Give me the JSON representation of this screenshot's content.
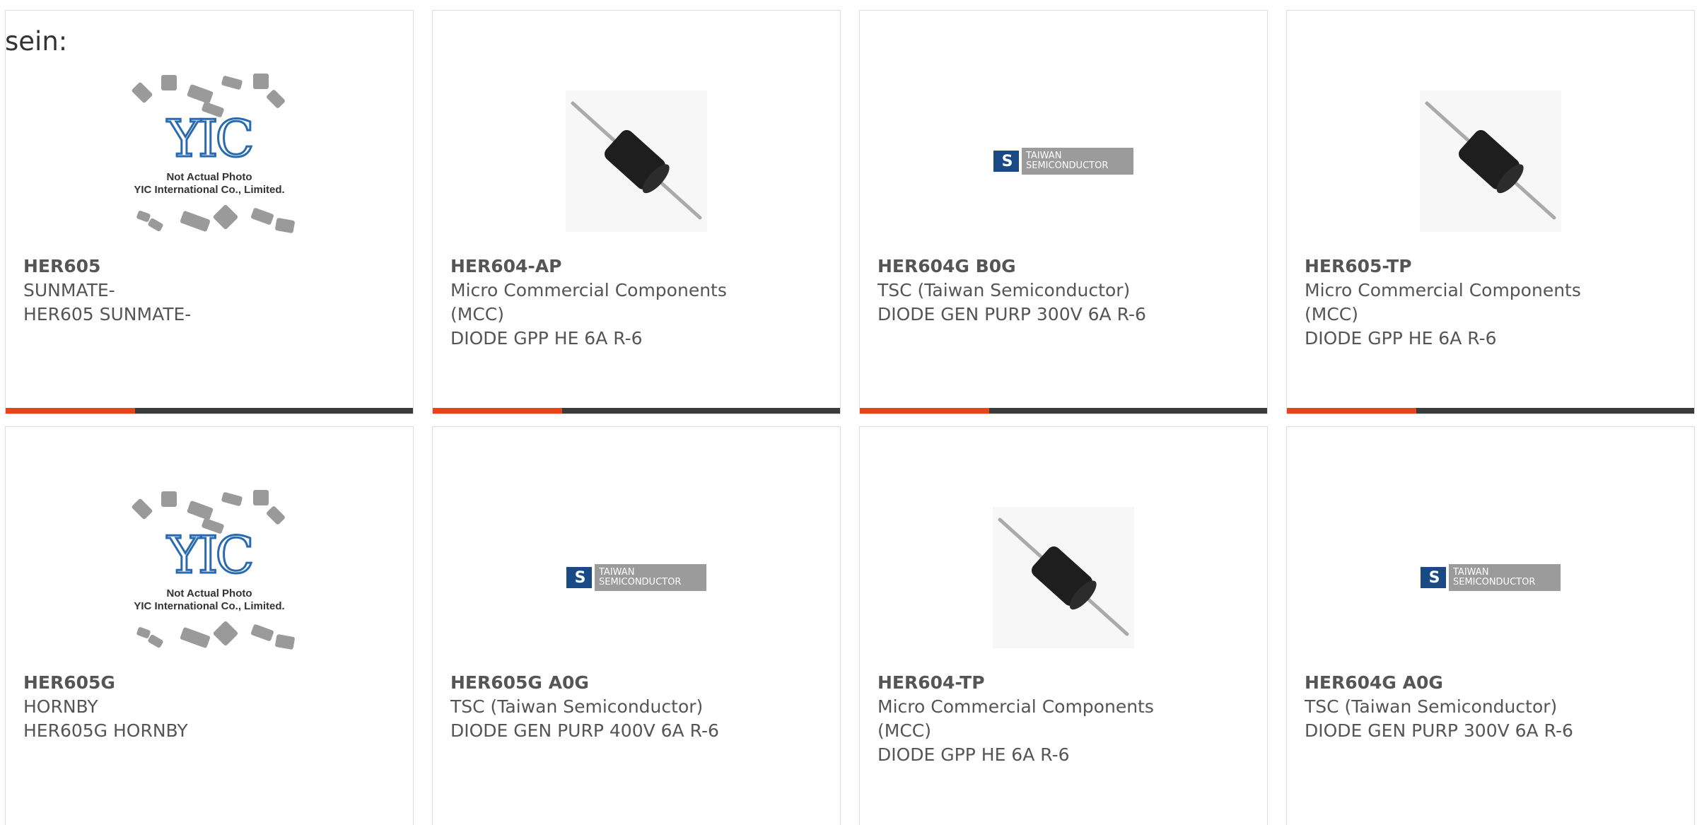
{
  "intro_text": "sein:",
  "placeholder": {
    "logo_text": "YIC",
    "caption_line1": "Not Actual Photo",
    "caption_line2": "YIC International Co., Limited."
  },
  "tsc_logo": {
    "mark": "S",
    "line1": "TAIWAN",
    "line2": "SEMICONDUCTOR"
  },
  "colors": {
    "accent": "#e8431a",
    "bar": "#3b3b3b",
    "text": "#555555"
  },
  "products": [
    {
      "part_number": "HER605",
      "lines": [
        "SUNMATE-",
        "HER605 SUNMATE-"
      ],
      "image": "yic-placeholder"
    },
    {
      "part_number": "HER604-AP",
      "lines": [
        "Micro Commercial Components",
        "(MCC)",
        "DIODE GPP HE 6A R-6"
      ],
      "image": "diode-photo"
    },
    {
      "part_number": "HER604G B0G",
      "lines": [
        "TSC (Taiwan Semiconductor)",
        "DIODE GEN PURP 300V 6A R-6"
      ],
      "image": "tsc-logo"
    },
    {
      "part_number": "HER605-TP",
      "lines": [
        "Micro Commercial Components",
        "(MCC)",
        "DIODE GPP HE 6A R-6"
      ],
      "image": "diode-photo"
    },
    {
      "part_number": "HER605G",
      "lines": [
        "HORNBY",
        "HER605G HORNBY"
      ],
      "image": "yic-placeholder"
    },
    {
      "part_number": "HER605G A0G",
      "lines": [
        "TSC (Taiwan Semiconductor)",
        "DIODE GEN PURP 400V 6A R-6"
      ],
      "image": "tsc-logo"
    },
    {
      "part_number": "HER604-TP",
      "lines": [
        "Micro Commercial Components",
        "(MCC)",
        "DIODE GPP HE 6A R-6"
      ],
      "image": "diode-photo"
    },
    {
      "part_number": "HER604G A0G",
      "lines": [
        "TSC (Taiwan Semiconductor)",
        "DIODE GEN PURP 300V 6A R-6"
      ],
      "image": "tsc-logo"
    }
  ]
}
